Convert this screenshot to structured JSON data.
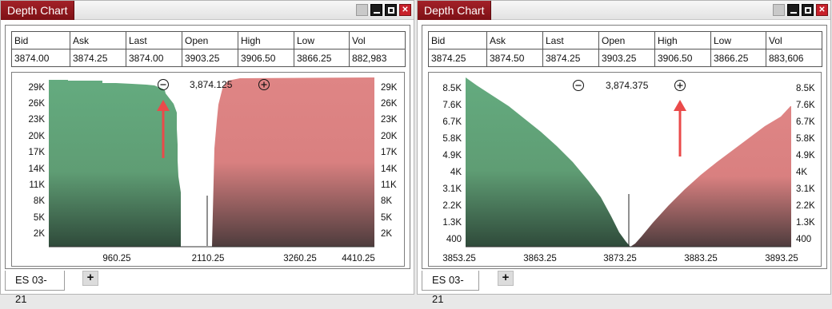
{
  "windows": [
    {
      "title": "Depth Chart",
      "tab_label": "ES 03-21",
      "add_tab_label": "+",
      "quote": {
        "headers": [
          "Bid",
          "Ask",
          "Last",
          "Open",
          "High",
          "Low",
          "Vol"
        ],
        "values": [
          "3874.00",
          "3874.25",
          "3874.00",
          "3903.25",
          "3906.50",
          "3866.25",
          "882,983"
        ]
      },
      "chart": {
        "zoom_out_icon": "zoom-out-icon",
        "zoom_in_icon": "zoom-in-icon",
        "mid_price": "3,874.125",
        "x_ticks": [
          "960.25",
          "2110.25",
          "3260.25",
          "4410.25"
        ],
        "y_ticks": [
          "29K",
          "26K",
          "23K",
          "20K",
          "17K",
          "14K",
          "11K",
          "8K",
          "5K",
          "2K"
        ],
        "annotation": "red-arrow-pointing-up"
      }
    },
    {
      "title": "Depth Chart",
      "tab_label": "ES 03-21",
      "add_tab_label": "+",
      "quote": {
        "headers": [
          "Bid",
          "Ask",
          "Last",
          "Open",
          "High",
          "Low",
          "Vol"
        ],
        "values": [
          "3874.25",
          "3874.50",
          "3874.25",
          "3903.25",
          "3906.50",
          "3866.25",
          "883,606"
        ]
      },
      "chart": {
        "zoom_out_icon": "zoom-out-icon",
        "zoom_in_icon": "zoom-in-icon",
        "mid_price": "3,874.375",
        "x_ticks": [
          "3853.25",
          "3863.25",
          "3873.25",
          "3883.25",
          "3893.25"
        ],
        "y_ticks": [
          "8.5K",
          "7.6K",
          "6.7K",
          "5.8K",
          "4.9K",
          "4K",
          "3.1K",
          "2.2K",
          "1.3K",
          "400"
        ],
        "annotation": "red-arrow-pointing-up"
      }
    }
  ],
  "colors": {
    "title_tab": "#8f181e",
    "bid_fill_top": "#64ab7f",
    "bid_fill_bottom": "#2f4a3a",
    "ask_fill_top": "#df8585",
    "ask_fill_bottom": "#4e3c3d",
    "arrow": "#ea4a4a"
  }
}
